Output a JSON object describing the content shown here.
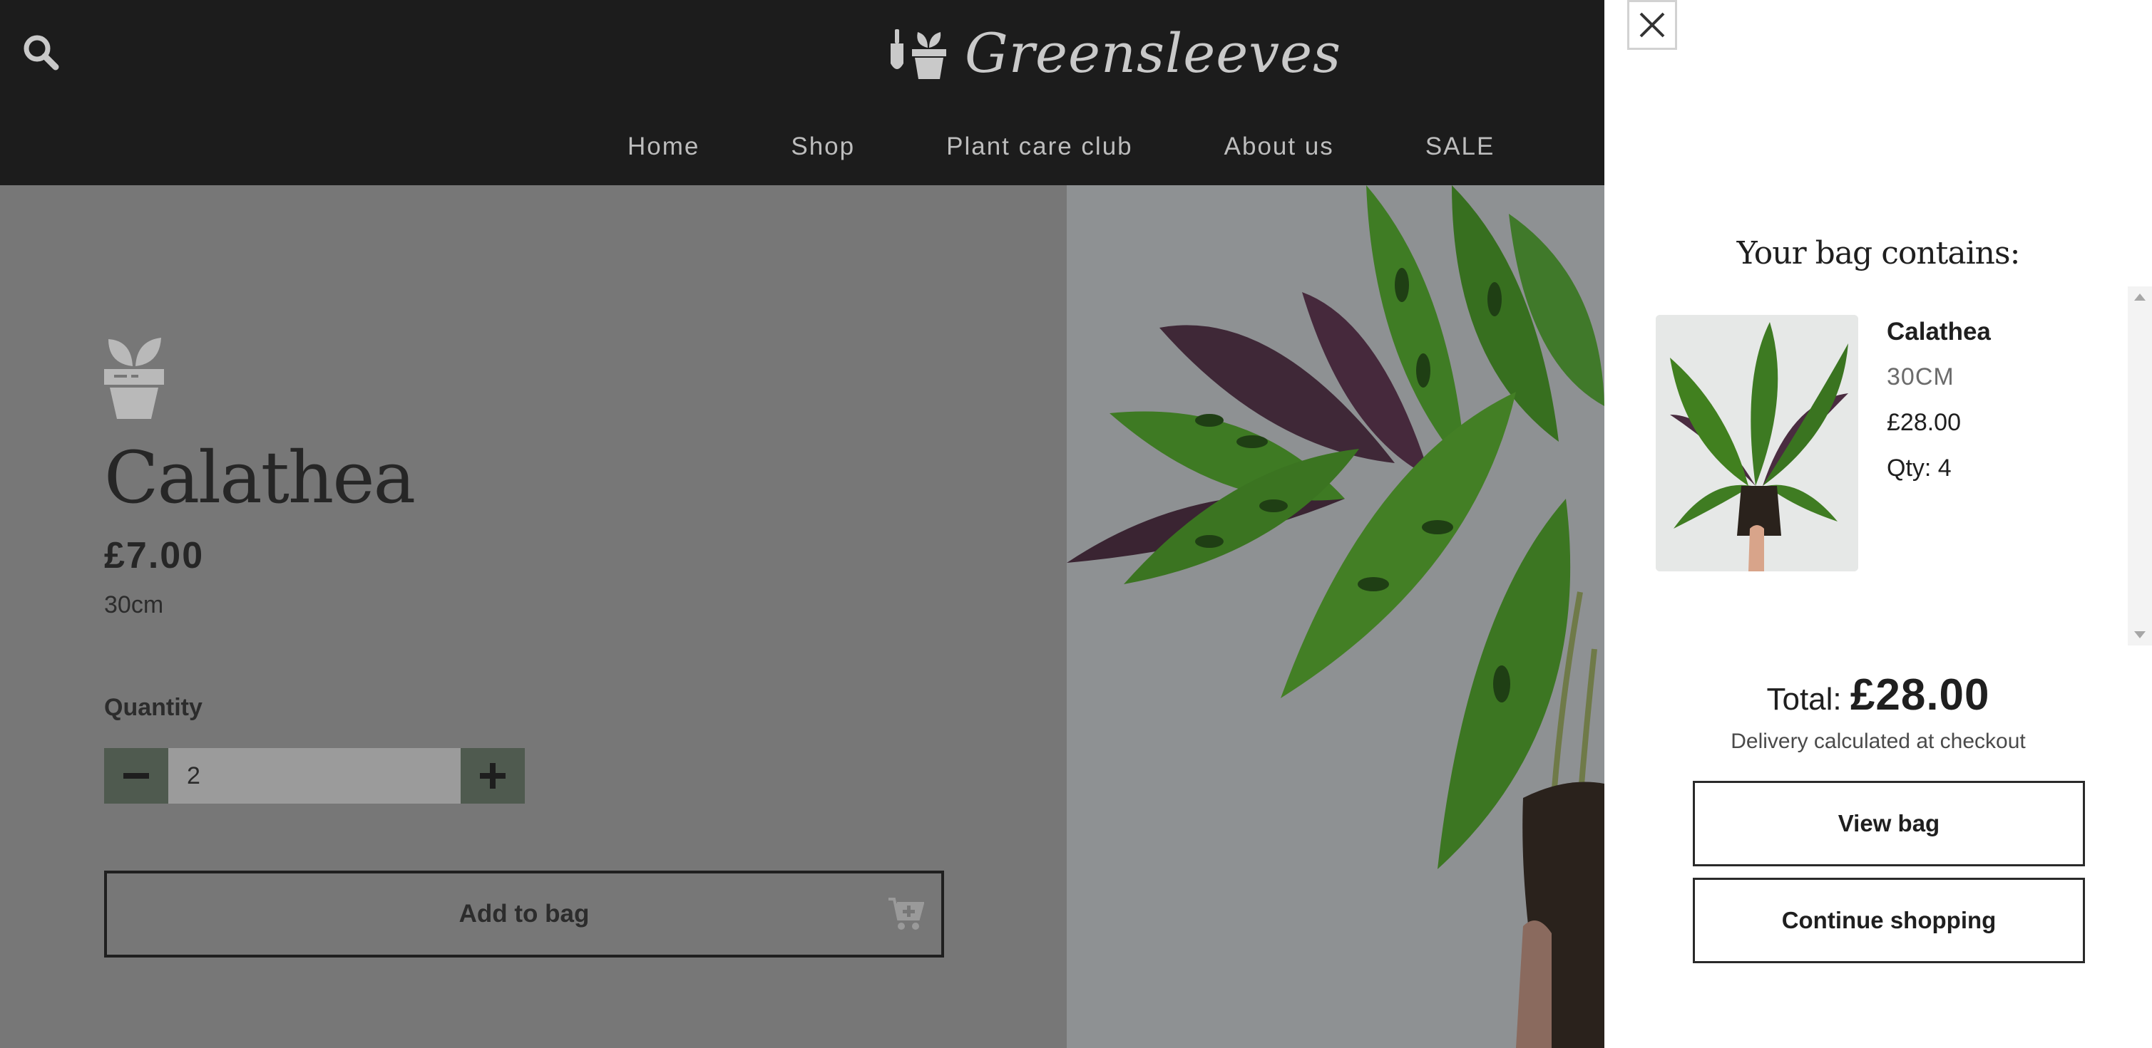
{
  "header": {
    "brand": "Greensleeves",
    "search_icon": "search-icon",
    "nav": [
      {
        "label": "Home"
      },
      {
        "label": "Shop"
      },
      {
        "label": "Plant care club"
      },
      {
        "label": "About us"
      },
      {
        "label": "SALE"
      }
    ]
  },
  "product": {
    "icon": "plant-pot-icon",
    "title": "Calathea",
    "price": "£7.00",
    "size": "30cm",
    "quantity_label": "Quantity",
    "quantity_value": "2",
    "add_to_bag_label": "Add to bag",
    "cart_icon": "cart-plus-icon"
  },
  "drawer": {
    "close_icon": "close-icon",
    "title": "Your bag contains:",
    "items": [
      {
        "name": "Calathea",
        "variant": "30CM",
        "price": "£28.00",
        "qty": "Qty: 4"
      }
    ],
    "total_label": "Total:",
    "total_value": "£28.00",
    "delivery_note": "Delivery calculated at checkout",
    "view_bag_label": "View bag",
    "continue_label": "Continue shopping"
  },
  "colors": {
    "header_bg": "#1c1c1c",
    "overlay_bg": "#777777",
    "stepper_bg": "#4f5a4f",
    "drawer_bg": "#ffffff",
    "leaf_green": "#3f7a23",
    "leaf_purple": "#4a2a40"
  }
}
